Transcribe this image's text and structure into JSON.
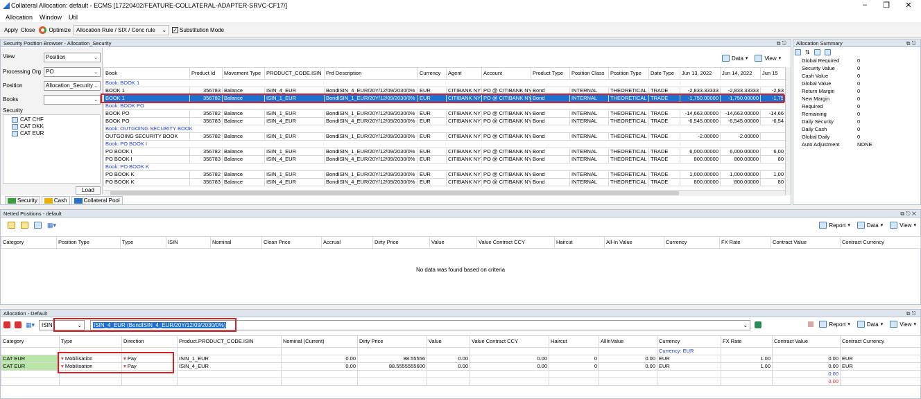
{
  "window": {
    "title": "Collateral Allocation: default - ECMS [17220402/FEATURE-COLLATERAL-ADAPTER-SRVC-CF17/]"
  },
  "menu": [
    "Allocation",
    "Window",
    "Util"
  ],
  "toolbar": {
    "apply": "Apply",
    "close": "Close",
    "optimize": "Optimize",
    "rule": "Allocation Rule / SIX / Conc rule",
    "substitution": "Substitution Mode"
  },
  "browser": {
    "title": "Security Position Browser - Allocation_Security",
    "filters": {
      "view_label": "View",
      "view_value": "Position",
      "org_label": "Processing Org",
      "org_value": "PO",
      "position_label": "Position",
      "position_value": "Allocation_Security",
      "books_label": "Books",
      "books_value": "",
      "security_label": "Security"
    },
    "tree": [
      "CAT CHF",
      "CAT DKK",
      "CAT EUR"
    ],
    "load": "Load",
    "data_btn": "Data",
    "view_btn": "View",
    "columns": [
      "Book",
      "Product Id",
      "Movement Type",
      "PRODUCT_CODE.ISIN",
      "Prd Description",
      "Currency",
      "Agent",
      "Account",
      "Product Type",
      "Position Class",
      "Position Type",
      "Date Type",
      "Jun 13, 2022",
      "Jun 14, 2022",
      "Jun 15"
    ],
    "rows": [
      {
        "group": "Book: BOOK 1"
      },
      {
        "c": [
          "BOOK 1",
          "356783",
          "Balance",
          "ISIN_4_EUR",
          "BondISIN_4_EUR/20Y/12/09/2030/0%",
          "EUR",
          "CITIBANK NY",
          "PO @ CITIBANK NY",
          "Bond",
          "INTERNAL",
          "THEORETICAL",
          "TRADE",
          "-2,833.33333",
          "-2,833.33333",
          "-2,83"
        ]
      },
      {
        "c": [
          "BOOK 1",
          "356782",
          "Balance",
          "ISIN_1_EUR",
          "BondISIN_1_EUR/20Y/12/09/2030/0%",
          "EUR",
          "CITIBANK NY",
          "PO @ CITIBANK NY",
          "Bond",
          "INTERNAL",
          "THEORETICAL",
          "TRADE",
          "-1,750.00000",
          "-1,750.00000",
          "-1,75"
        ],
        "sel": true
      },
      {
        "group": "Book: BOOK PO"
      },
      {
        "c": [
          "BOOK PO",
          "356782",
          "Balance",
          "ISIN_1_EUR",
          "BondISIN_1_EUR/20Y/12/09/2030/0%",
          "EUR",
          "CITIBANK NY",
          "PO @ CITIBANK NY",
          "Bond",
          "INTERNAL",
          "THEORETICAL",
          "TRADE",
          "-14,663.00000",
          "-14,663.00000",
          "-14,66"
        ]
      },
      {
        "c": [
          "BOOK PO",
          "356783",
          "Balance",
          "ISIN_4_EUR",
          "BondISIN_4_EUR/20Y/12/09/2030/0%",
          "EUR",
          "CITIBANK NY",
          "PO @ CITIBANK NY",
          "Bond",
          "INTERNAL",
          "THEORETICAL",
          "TRADE",
          "-6,545.00000",
          "-6,545.00000",
          "-6,54"
        ]
      },
      {
        "group": "Book: OUTGOING SECURITY BOOK"
      },
      {
        "c": [
          "OUTGOING SECURITY BOOK",
          "356782",
          "Balance",
          "ISIN_1_EUR",
          "BondISIN_1_EUR/20Y/12/09/2030/0%",
          "EUR",
          "CITIBANK NY",
          "PO @ CITIBANK NY",
          "Bond",
          "INTERNAL",
          "THEORETICAL",
          "TRADE",
          "-2.00000",
          "-2.00000",
          ""
        ]
      },
      {
        "group": "Book: PO BOOK I"
      },
      {
        "c": [
          "PO BOOK I",
          "356782",
          "Balance",
          "ISIN_1_EUR",
          "BondISIN_1_EUR/20Y/12/09/2030/0%",
          "EUR",
          "CITIBANK NY",
          "PO @ CITIBANK NY",
          "Bond",
          "INTERNAL",
          "THEORETICAL",
          "TRADE",
          "6,000.00000",
          "6,000.00000",
          "6,00"
        ]
      },
      {
        "c": [
          "PO BOOK I",
          "356783",
          "Balance",
          "ISIN_4_EUR",
          "BondISIN_4_EUR/20Y/12/09/2030/0%",
          "EUR",
          "CITIBANK NY",
          "PO @ CITIBANK NY",
          "Bond",
          "INTERNAL",
          "THEORETICAL",
          "TRADE",
          "800.00000",
          "800.00000",
          "80"
        ]
      },
      {
        "group": "Book: PO BOOK K"
      },
      {
        "c": [
          "PO BOOK K",
          "356782",
          "Balance",
          "ISIN_1_EUR",
          "BondISIN_1_EUR/20Y/12/09/2030/0%",
          "EUR",
          "CITIBANK NY",
          "PO @ CITIBANK NY",
          "Bond",
          "INTERNAL",
          "THEORETICAL",
          "TRADE",
          "1,000.00000",
          "1,000.00000",
          "1,00"
        ]
      },
      {
        "c": [
          "PO BOOK K",
          "356783",
          "Balance",
          "ISIN_4_EUR",
          "BondISIN_4_EUR/20Y/12/09/2030/0%",
          "EUR",
          "CITIBANK NY",
          "PO @ CITIBANK NY",
          "Bond",
          "INTERNAL",
          "THEORETICAL",
          "TRADE",
          "800.00000",
          "800.00000",
          "80"
        ]
      }
    ],
    "tabs": [
      "Security",
      "Cash",
      "Collateral Pool"
    ]
  },
  "summary": {
    "title": "Allocation Summary",
    "items": [
      {
        "k": "Global Required",
        "v": "0"
      },
      {
        "k": "Security Value",
        "v": "0"
      },
      {
        "k": "Cash Value",
        "v": "0"
      },
      {
        "k": "Global Value",
        "v": "0"
      },
      {
        "k": "Return Margin",
        "v": "0"
      },
      {
        "k": "New Margin",
        "v": "0"
      },
      {
        "k": "Required",
        "v": "0"
      },
      {
        "k": "Remaining",
        "v": "0"
      },
      {
        "k": "Daily Security",
        "v": "0"
      },
      {
        "k": "Daily Cash",
        "v": "0"
      },
      {
        "k": "Global Daily",
        "v": "0"
      },
      {
        "k": "Auto Adjustment",
        "v": "NONE"
      }
    ]
  },
  "netted": {
    "title": "Netted Positions - default",
    "report": "Report",
    "data": "Data",
    "view": "View",
    "columns": [
      "Category",
      "Position Type",
      "Type",
      "ISIN",
      "Nominal",
      "Clean Price",
      "Accrual",
      "Dirty Price",
      "Value",
      "Value Contract CCY",
      "Haircut",
      "All-In Value",
      "Currency",
      "FX Rate",
      "Contract Value",
      "Contract Currency"
    ],
    "empty": "No data was found based on criteria"
  },
  "allocation": {
    "title": "Allocation - Default",
    "isin_combo": "ISIN",
    "isin_value": "ISIN_4_EUR (BondISIN_4_EUR/20Y/12/09/2030/0%)",
    "report": "Report",
    "data": "Data",
    "view": "View",
    "columns": [
      "Category",
      "Type",
      "Direction",
      "Product.PRODUCT_CODE.ISIN",
      "Nominal (Current)",
      "Dirty Price",
      "Value",
      "Value Contract CCY",
      "Haircut",
      "AllInValue",
      "Currency",
      "FX Rate",
      "Contract Value",
      "Contract Currency"
    ],
    "currency_group": "Currency: EUR",
    "rows": [
      [
        "CAT EUR",
        "Mobilisation",
        "Pay",
        "ISIN_1_EUR",
        "0.00",
        "88.55556",
        "0.00",
        "0.00",
        "0",
        "0.00",
        "EUR",
        "1.00",
        "0.00",
        "EUR"
      ],
      [
        "CAT EUR",
        "Mobilisation",
        "Pay",
        "ISIN_4_EUR",
        "0.00",
        "88.5555555600",
        "0.00",
        "0.00",
        "0",
        "0.00",
        "EUR",
        "1.00",
        "0.00",
        "EUR"
      ]
    ],
    "totals": [
      "0.00",
      "0.00"
    ],
    "colors": {
      "blue_total": "#1f3fd0",
      "red_total": "#d81f26"
    }
  },
  "colors": {
    "selection": "#1d6fd0",
    "highlight": "#d81f26",
    "category_bg": "#b9e5a8"
  }
}
